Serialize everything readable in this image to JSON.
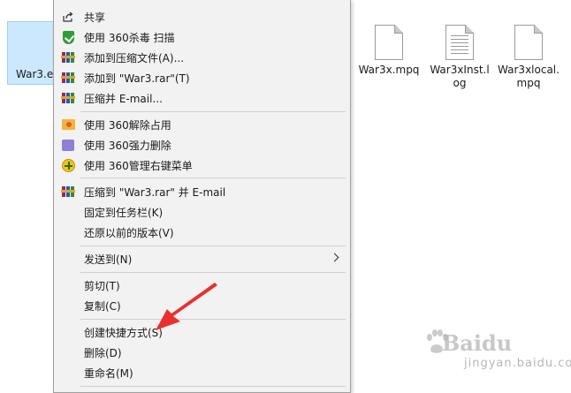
{
  "desktop": {
    "selected_file": "War3.e",
    "files": [
      {
        "name": "War3x.mpq",
        "icon": "blank-file-icon"
      },
      {
        "name": "War3xInst.log",
        "icon": "text-file-icon"
      },
      {
        "name": "War3xlocal.mpq",
        "icon": "blank-file-icon"
      }
    ]
  },
  "menu": {
    "items": [
      {
        "label": "共享",
        "icon": "share-icon"
      },
      {
        "label": "使用 360杀毒 扫描",
        "icon": "360-shield-icon"
      },
      {
        "label": "添加到压缩文件(A)...",
        "icon": "winrar-icon"
      },
      {
        "label": "添加到 \"War3.rar\"(T)",
        "icon": "winrar-icon"
      },
      {
        "label": "压缩并 E-mail...",
        "icon": "winrar-icon"
      },
      {
        "label": "使用 360解除占用",
        "icon": "360-unlock-icon"
      },
      {
        "label": "使用 360强力删除",
        "icon": "360-delete-icon"
      },
      {
        "label": "使用 360管理右键菜单",
        "icon": "360-menu-manager-icon"
      },
      {
        "label": "压缩到 \"War3.rar\" 并 E-mail",
        "icon": "winrar-icon"
      },
      {
        "label": "固定到任务栏(K)"
      },
      {
        "label": "还原以前的版本(V)"
      },
      {
        "label": "发送到(N)",
        "submenu": true
      },
      {
        "label": "剪切(T)"
      },
      {
        "label": "复制(C)"
      },
      {
        "label": "创建快捷方式(S)"
      },
      {
        "label": "删除(D)"
      },
      {
        "label": "重命名(M)"
      }
    ]
  },
  "annotation": {
    "color": "#e8312f",
    "points_to": "创建快捷方式(S)"
  },
  "watermark": {
    "brand": "Baidu",
    "text": "jingyan.baidu.com"
  }
}
